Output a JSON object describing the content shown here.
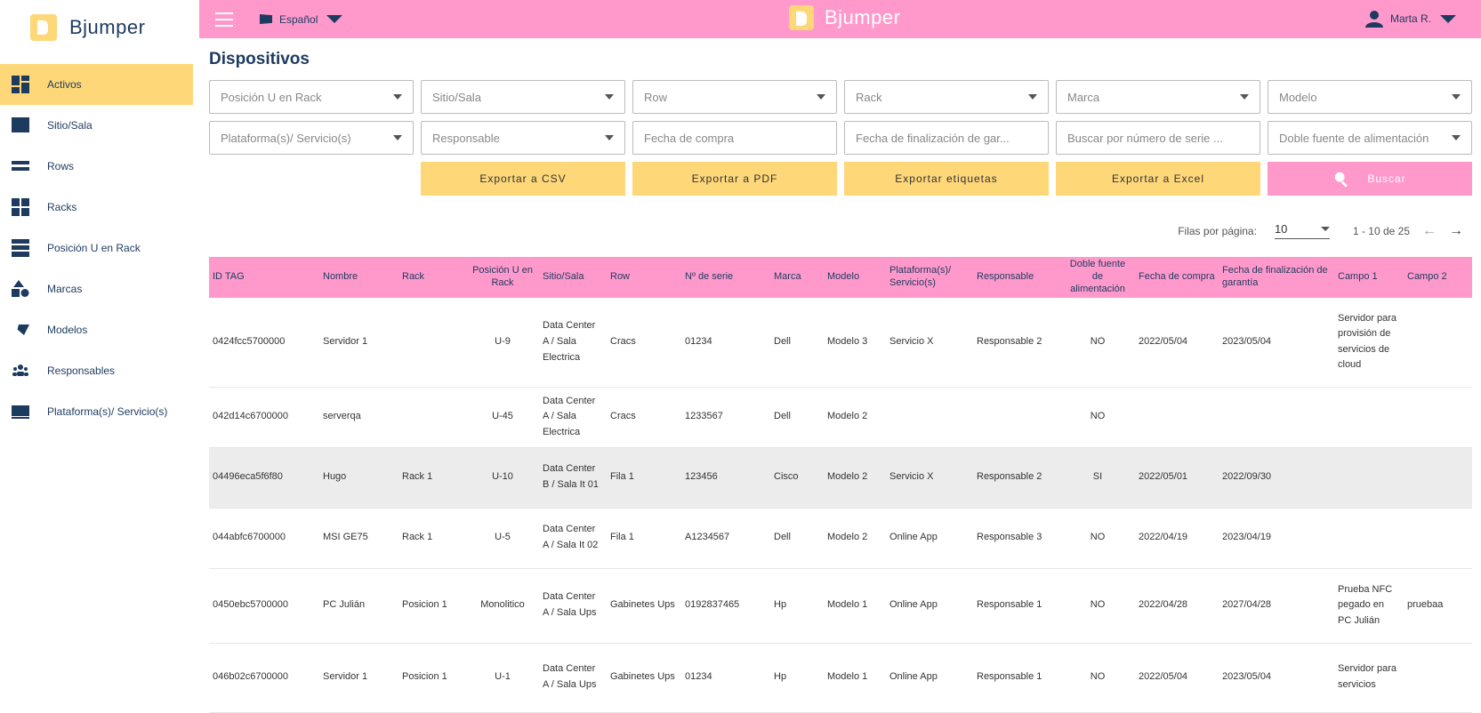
{
  "brand": {
    "name": "Bjumper"
  },
  "sidebar": {
    "items": [
      {
        "label": "Activos",
        "icon": "dashboard-grid-icon"
      },
      {
        "label": "Sitio/Sala",
        "icon": "square-icon"
      },
      {
        "label": "Rows",
        "icon": "rows-icon"
      },
      {
        "label": "Racks",
        "icon": "grid-icon"
      },
      {
        "label": "Posición U en Rack",
        "icon": "rack-units-icon"
      },
      {
        "label": "Marcas",
        "icon": "shapes-icon"
      },
      {
        "label": "Modelos",
        "icon": "model-icon"
      },
      {
        "label": "Responsables",
        "icon": "people-icon"
      },
      {
        "label": "Plataforma(s)/ Servicio(s)",
        "icon": "monitor-icon"
      }
    ]
  },
  "topbar": {
    "language": "Español",
    "user": "Marta R."
  },
  "page": {
    "title": "Dispositivos"
  },
  "filters": {
    "row1": [
      "Posición U en Rack",
      "Sitio/Sala",
      "Row",
      "Rack",
      "Marca",
      "Modelo"
    ],
    "responsible": "Plataforma(s)/ Servicio(s)",
    "responsable": "Responsable",
    "purchase_date": "Fecha de compra",
    "warranty_end": "Fecha de finalización de gar...",
    "serial_search": "Buscar por número de serie ...",
    "dual_power": "Doble fuente de alimentación"
  },
  "buttons": {
    "csv": "Exportar a CSV",
    "pdf": "Exportar a PDF",
    "labels": "Exportar etiquetas",
    "excel": "Exportar a Excel",
    "search": "Buscar"
  },
  "pagination": {
    "rows_label": "Filas por página:",
    "rows_value": "10",
    "range": "1 - 10 de 25"
  },
  "table": {
    "headers": [
      "ID TAG",
      "Nombre",
      "Rack",
      "Posición U en Rack",
      "Sitio/Sala",
      "Row",
      "Nº de serie",
      "Marca",
      "Modelo",
      "Plataforma(s)/ Servicio(s)",
      "Responsable",
      "Doble fuente de alimentación",
      "Fecha de compra",
      "Fecha de finalización de garantía",
      "Campo 1",
      "Campo 2"
    ],
    "rows": [
      [
        "0424fcc5700000",
        "Servidor 1",
        "",
        "U-9",
        "Data Center A / Sala Electrica",
        "Cracs",
        "01234",
        "Dell",
        "Modelo 3",
        "Servicio X",
        "Responsable 2",
        "NO",
        "2022/05/04",
        "2023/05/04",
        "Servidor para provisión de servicios de cloud",
        ""
      ],
      [
        "042d14c6700000",
        "serverqa",
        "",
        "U-45",
        "Data Center A / Sala Electrica",
        "Cracs",
        "1233567",
        "Dell",
        "Modelo 2",
        "",
        "",
        "NO",
        "",
        "",
        "",
        ""
      ],
      [
        "04496eca5f6f80",
        "Hugo",
        "Rack 1",
        "U-10",
        "Data Center B / Sala It 01",
        "Fila 1",
        "123456",
        "Cisco",
        "Modelo 2",
        "Servicio X",
        "Responsable 2",
        "SI",
        "2022/05/01",
        "2022/09/30",
        "",
        ""
      ],
      [
        "044abfc6700000",
        "MSI GE75",
        "Rack 1",
        "U-5",
        "Data Center A / Sala It 02",
        "Fila 1",
        "A1234567",
        "Dell",
        "Modelo 2",
        "Online App",
        "Responsable 3",
        "NO",
        "2022/04/19",
        "2023/04/19",
        "",
        ""
      ],
      [
        "0450ebc5700000",
        "PC Julián",
        "Posicion 1",
        "Monolitico",
        "Data Center A / Sala Ups",
        "Gabinetes Ups",
        "0192837465",
        "Hp",
        "Modelo 1",
        "Online App",
        "Responsable 1",
        "NO",
        "2022/04/28",
        "2027/04/28",
        "Prueba NFC pegado en PC Julián",
        "pruebaa"
      ],
      [
        "046b02c6700000",
        "Servidor 1",
        "Posicion 1",
        "U-1",
        "Data Center A / Sala Ups",
        "Gabinetes Ups",
        "01234",
        "Hp",
        "Modelo 1",
        "Online App",
        "Responsable 1",
        "NO",
        "2022/05/04",
        "2023/05/04",
        "Servidor para servicios",
        ""
      ]
    ]
  }
}
